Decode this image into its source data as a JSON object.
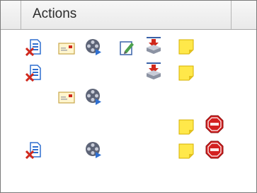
{
  "header": {
    "title": "Actions"
  },
  "icon_legend": {
    "delete_document": "document-with-red-x-icon",
    "email": "email-envelope-icon",
    "film_reel": "film-reel-play-icon",
    "edit": "edit-notepad-icon",
    "download": "download-to-tray-icon",
    "sticky_note": "sticky-note-icon",
    "stop": "stop-sign-icon"
  },
  "colors": {
    "header_bg": "#ededed",
    "border": "#7a7a7a",
    "stop_red": "#d32020",
    "note_yellow": "#ffe84a",
    "x_red": "#d0281c",
    "doc_blue": "#2f6fcf"
  }
}
